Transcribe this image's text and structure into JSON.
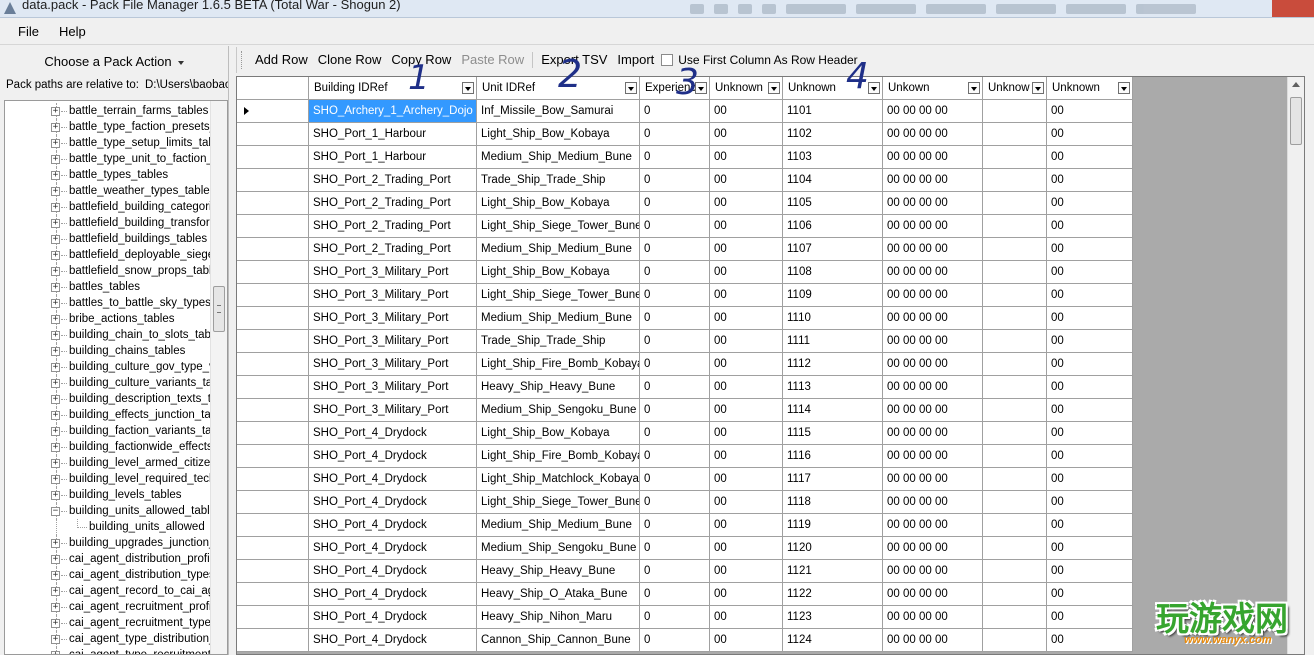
{
  "window": {
    "title": "data.pack - Pack File Manager 1.6.5 BETA (Total War - Shogun 2)"
  },
  "menu": {
    "items": [
      "File",
      "Help"
    ]
  },
  "left": {
    "pack_action": "Choose a Pack Action",
    "pack_paths_label": "Pack paths are relative to:",
    "pack_paths_value": "D:\\Users\\baobao\\"
  },
  "tree": {
    "items": [
      {
        "label": "battle_terrain_farms_tables",
        "expander": "+"
      },
      {
        "label": "battle_type_faction_presets_ta",
        "expander": "+"
      },
      {
        "label": "battle_type_setup_limits_tables",
        "expander": "+"
      },
      {
        "label": "battle_type_unit_to_faction_pr",
        "expander": "+"
      },
      {
        "label": "battle_types_tables",
        "expander": "+"
      },
      {
        "label": "battle_weather_types_tables",
        "expander": "+"
      },
      {
        "label": "battlefield_building_categories",
        "expander": "+"
      },
      {
        "label": "battlefield_building_transformat",
        "expander": "+"
      },
      {
        "label": "battlefield_buildings_tables",
        "expander": "+"
      },
      {
        "label": "battlefield_deployable_siege_it",
        "expander": "+"
      },
      {
        "label": "battlefield_snow_props_tables",
        "expander": "+"
      },
      {
        "label": "battles_tables",
        "expander": "+"
      },
      {
        "label": "battles_to_battle_sky_types_ju",
        "expander": "+"
      },
      {
        "label": "bribe_actions_tables",
        "expander": "+"
      },
      {
        "label": "building_chain_to_slots_tables",
        "expander": "+"
      },
      {
        "label": "building_chains_tables",
        "expander": "+"
      },
      {
        "label": "building_culture_gov_type_var",
        "expander": "+"
      },
      {
        "label": "building_culture_variants_table",
        "expander": "+"
      },
      {
        "label": "building_description_texts_tabl",
        "expander": "+"
      },
      {
        "label": "building_effects_junction_table",
        "expander": "+"
      },
      {
        "label": "building_faction_variants_table",
        "expander": "+"
      },
      {
        "label": "building_factionwide_effects_ju",
        "expander": "+"
      },
      {
        "label": "building_level_armed_citizenry",
        "expander": "+"
      },
      {
        "label": "building_level_required_techno",
        "expander": "+"
      },
      {
        "label": "building_levels_tables",
        "expander": "+"
      },
      {
        "label": "building_units_allowed_tables",
        "expander": "−"
      },
      {
        "label": "building_units_allowed",
        "expander": "",
        "child": true
      },
      {
        "label": "building_upgrades_junction_ta",
        "expander": "+"
      },
      {
        "label": "cai_agent_distribution_profiles",
        "expander": "+"
      },
      {
        "label": "cai_agent_distribution_types_t",
        "expander": "+"
      },
      {
        "label": "cai_agent_record_to_cai_agen",
        "expander": "+"
      },
      {
        "label": "cai_agent_recruitment_profiles",
        "expander": "+"
      },
      {
        "label": "cai_agent_recruitment_types_t",
        "expander": "+"
      },
      {
        "label": "cai_agent_type_distribution_pr",
        "expander": "+"
      },
      {
        "label": "cai_agent_type_recruitment_p",
        "expander": "+"
      }
    ]
  },
  "toolbar": {
    "add_row": "Add Row",
    "clone_row": "Clone Row",
    "copy_row": "Copy Row",
    "paste_row": "Paste Row",
    "export_tsv": "Export TSV",
    "import": "Import",
    "use_first_column": "Use First Column As Row Header"
  },
  "grid": {
    "columns": [
      "Building IDRef",
      "Unit IDRef",
      "Experienc",
      "Unknown",
      "Unknown",
      "Unkown",
      "Unknow",
      "Unknown"
    ],
    "rows": [
      [
        "SHO_Archery_1_Archery_Dojo",
        "Inf_Missile_Bow_Samurai",
        "0",
        "00",
        "1101",
        "00 00 00 00",
        "",
        "00"
      ],
      [
        "SHO_Port_1_Harbour",
        "Light_Ship_Bow_Kobaya",
        "0",
        "00",
        "1102",
        "00 00 00 00",
        "",
        "00"
      ],
      [
        "SHO_Port_1_Harbour",
        "Medium_Ship_Medium_Bune",
        "0",
        "00",
        "1103",
        "00 00 00 00",
        "",
        "00"
      ],
      [
        "SHO_Port_2_Trading_Port",
        "Trade_Ship_Trade_Ship",
        "0",
        "00",
        "1104",
        "00 00 00 00",
        "",
        "00"
      ],
      [
        "SHO_Port_2_Trading_Port",
        "Light_Ship_Bow_Kobaya",
        "0",
        "00",
        "1105",
        "00 00 00 00",
        "",
        "00"
      ],
      [
        "SHO_Port_2_Trading_Port",
        "Light_Ship_Siege_Tower_Bune",
        "0",
        "00",
        "1106",
        "00 00 00 00",
        "",
        "00"
      ],
      [
        "SHO_Port_2_Trading_Port",
        "Medium_Ship_Medium_Bune",
        "0",
        "00",
        "1107",
        "00 00 00 00",
        "",
        "00"
      ],
      [
        "SHO_Port_3_Military_Port",
        "Light_Ship_Bow_Kobaya",
        "0",
        "00",
        "1108",
        "00 00 00 00",
        "",
        "00"
      ],
      [
        "SHO_Port_3_Military_Port",
        "Light_Ship_Siege_Tower_Bune",
        "0",
        "00",
        "1109",
        "00 00 00 00",
        "",
        "00"
      ],
      [
        "SHO_Port_3_Military_Port",
        "Medium_Ship_Medium_Bune",
        "0",
        "00",
        "1110",
        "00 00 00 00",
        "",
        "00"
      ],
      [
        "SHO_Port_3_Military_Port",
        "Trade_Ship_Trade_Ship",
        "0",
        "00",
        "1111",
        "00 00 00 00",
        "",
        "00"
      ],
      [
        "SHO_Port_3_Military_Port",
        "Light_Ship_Fire_Bomb_Kobaya",
        "0",
        "00",
        "1112",
        "00 00 00 00",
        "",
        "00"
      ],
      [
        "SHO_Port_3_Military_Port",
        "Heavy_Ship_Heavy_Bune",
        "0",
        "00",
        "1113",
        "00 00 00 00",
        "",
        "00"
      ],
      [
        "SHO_Port_3_Military_Port",
        "Medium_Ship_Sengoku_Bune",
        "0",
        "00",
        "1114",
        "00 00 00 00",
        "",
        "00"
      ],
      [
        "SHO_Port_4_Drydock",
        "Light_Ship_Bow_Kobaya",
        "0",
        "00",
        "1115",
        "00 00 00 00",
        "",
        "00"
      ],
      [
        "SHO_Port_4_Drydock",
        "Light_Ship_Fire_Bomb_Kobaya",
        "0",
        "00",
        "1116",
        "00 00 00 00",
        "",
        "00"
      ],
      [
        "SHO_Port_4_Drydock",
        "Light_Ship_Matchlock_Kobaya",
        "0",
        "00",
        "1117",
        "00 00 00 00",
        "",
        "00"
      ],
      [
        "SHO_Port_4_Drydock",
        "Light_Ship_Siege_Tower_Bune",
        "0",
        "00",
        "1118",
        "00 00 00 00",
        "",
        "00"
      ],
      [
        "SHO_Port_4_Drydock",
        "Medium_Ship_Medium_Bune",
        "0",
        "00",
        "1119",
        "00 00 00 00",
        "",
        "00"
      ],
      [
        "SHO_Port_4_Drydock",
        "Medium_Ship_Sengoku_Bune",
        "0",
        "00",
        "1120",
        "00 00 00 00",
        "",
        "00"
      ],
      [
        "SHO_Port_4_Drydock",
        "Heavy_Ship_Heavy_Bune",
        "0",
        "00",
        "1121",
        "00 00 00 00",
        "",
        "00"
      ],
      [
        "SHO_Port_4_Drydock",
        "Heavy_Ship_O_Ataka_Bune",
        "0",
        "00",
        "1122",
        "00 00 00 00",
        "",
        "00"
      ],
      [
        "SHO_Port_4_Drydock",
        "Heavy_Ship_Nihon_Maru",
        "0",
        "00",
        "1123",
        "00 00 00 00",
        "",
        "00"
      ],
      [
        "SHO_Port_4_Drydock",
        "Cannon_Ship_Cannon_Bune",
        "0",
        "00",
        "1124",
        "00 00 00 00",
        "",
        "00"
      ]
    ]
  },
  "annotations": [
    "1",
    "2",
    "3",
    "4"
  ],
  "watermark": {
    "text": "玩游戏网",
    "url": "www.wanyx.com"
  },
  "colors": {
    "selection": "#3399ff",
    "annotation_ink": "#1f2f88",
    "watermark_green": "#37a52f"
  }
}
